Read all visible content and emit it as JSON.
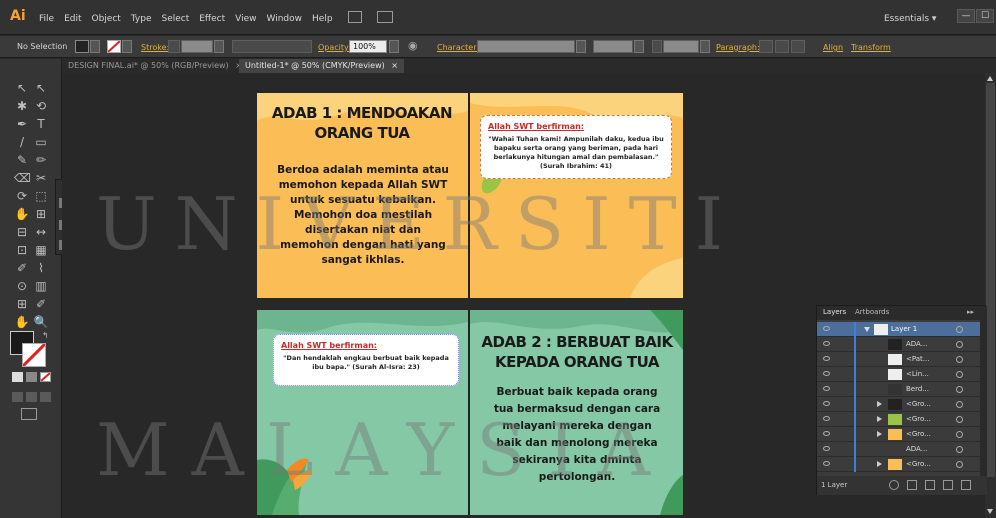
{
  "app": {
    "logo": "Ai"
  },
  "menu": [
    "File",
    "Edit",
    "Object",
    "Type",
    "Select",
    "Effect",
    "View",
    "Window",
    "Help"
  ],
  "workspace": {
    "label": "Essentials",
    "dropdown": "▾"
  },
  "window_buttons": {
    "minimize": "—",
    "maximize": "☐"
  },
  "control_bar": {
    "selection": "No Selection",
    "stroke_label": "Stroke:",
    "opacity_label": "Opacity:",
    "opacity_value": "100%",
    "character_label": "Character:",
    "paragraph_label": "Paragraph:",
    "align_label": "Align",
    "transform_label": "Transform"
  },
  "tabs": [
    {
      "label": "DESIGN FINAL.ai* @ 50% (RGB/Preview)",
      "close": "×"
    },
    {
      "label": "Untitled-1* @ 50% (CMYK/Preview)",
      "close": "×"
    }
  ],
  "tools": [
    "↖",
    "↖",
    "✱",
    "⟲",
    "✒",
    "T",
    "/",
    "▭",
    "✎",
    "✏",
    "⌫",
    "✂",
    "⟳",
    "⬚",
    "✋",
    "⊞",
    "⊟",
    "↔",
    "⊡",
    "▦",
    "✐",
    "⌇",
    "⊙",
    "▥",
    "⊞",
    "✐",
    "✋",
    "🔍"
  ],
  "artboards": {
    "page1": {
      "title": "ADAB 1 : MENDOAKAN ORANG TUA",
      "body": "Berdoa adalah meminta atau memohon kepada Allah SWT untuk sesuatu kebaikan. Memohon doa mestilah disertakan niat dan memohon dengan hati yang sangat ikhlas."
    },
    "page2": {
      "quote_heading": "Allah SWT berfirman:",
      "quote_body": "\"Wahai Tuhan kami! Ampunilah daku, kedua ibu bapaku serta orang yang beriman, pada hari berlakunya hitungan amal dan pembalasan.\" (Surah Ibrahim: 41)"
    },
    "page3": {
      "quote_heading": "Allah SWT berfirman:",
      "quote_body": "\"Dan hendaklah engkau berbuat baik kepada ibu bapa.\" (Surah Al-Isra: 23)"
    },
    "page4": {
      "title": "ADAB 2 : BERBUAT BAIK KEPADA ORANG TUA",
      "body": "Berbuat baik kepada orang tua bermaksud dengan cara melayani mereka dengan baik dan menolong mereka sekiranya kita dminta pertolongan."
    }
  },
  "watermark": {
    "line1": "UNIVERSITI",
    "line2": "MALAYSIA"
  },
  "layers_panel": {
    "tabs": [
      "Layers",
      "Artboards"
    ],
    "menu_icon": "▸▸",
    "rows": [
      {
        "name": "Layer 1",
        "selected": true,
        "expand": "down"
      },
      {
        "name": "ADA...",
        "selected": false,
        "expand": ""
      },
      {
        "name": "<Pat...",
        "selected": false,
        "expand": ""
      },
      {
        "name": "<Lin...",
        "selected": false,
        "expand": ""
      },
      {
        "name": "Berd...",
        "selected": false,
        "expand": ""
      },
      {
        "name": "<Gro...",
        "selected": false,
        "expand": "right"
      },
      {
        "name": "<Gro...",
        "selected": false,
        "expand": "right"
      },
      {
        "name": "<Gro...",
        "selected": false,
        "expand": "right"
      },
      {
        "name": "ADA...",
        "selected": false,
        "expand": ""
      },
      {
        "name": "<Gro...",
        "selected": false,
        "expand": "right"
      }
    ],
    "footer": "1 Layer"
  },
  "colors": {
    "accent": "#f7a233",
    "page_yellow": "#fbbe56",
    "page_green": "#84c8a6",
    "quote_red": "#c52b2b",
    "layer_bar": "#3d7fd9"
  }
}
